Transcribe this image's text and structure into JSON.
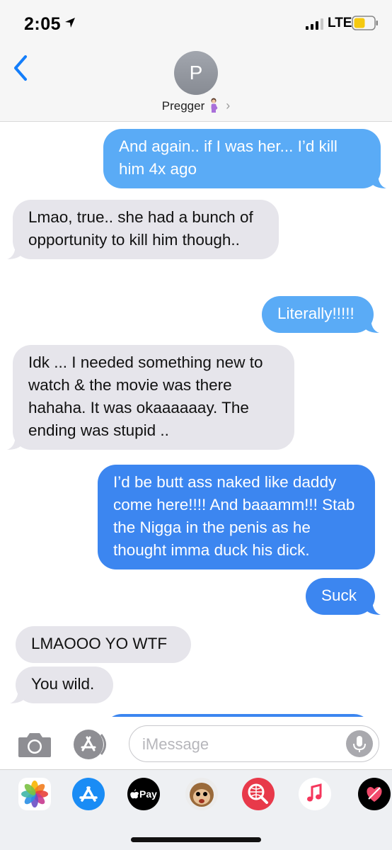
{
  "status_bar": {
    "time": "2:05",
    "network": "LTE"
  },
  "header": {
    "avatar_initial": "P",
    "contact_name": "Pregger"
  },
  "messages": [
    {
      "from": "me",
      "type": "sms",
      "text": "And again.. if I was her... I’d kill him 4x ago"
    },
    {
      "from": "them",
      "text": "Lmao, true.. she had a bunch of opportunity to kill him though.."
    },
    {
      "from": "me",
      "type": "sms",
      "text": "Literally!!!!!"
    },
    {
      "from": "them",
      "text": "Idk ... I needed something new to watch & the movie was there hahaha. It was okaaaaaay. The ending was stupid .."
    },
    {
      "from": "me",
      "type": "imessage",
      "text": "I’d be butt ass naked like daddy come here!!!! And baaamm!!! Stab the Nigga in the penis as he thought imma duck his dick."
    },
    {
      "from": "me",
      "type": "imessage",
      "text": "Suck"
    },
    {
      "from": "them",
      "text": "LMAOOO YO WTF"
    },
    {
      "from": "them",
      "text": "You wild."
    }
  ],
  "composer": {
    "placeholder": "iMessage"
  },
  "app_drawer": {
    "apps": [
      "photos-icon",
      "app-store-icon",
      "apple-pay-icon",
      "animoji-icon",
      "web-images-icon",
      "music-icon",
      "digital-touch-icon"
    ],
    "apple_pay_label": "Pay"
  },
  "colors": {
    "sms_bubble": "#5aabf6",
    "imessage_bubble": "#3c86f0",
    "received_bubble": "#e6e5eb",
    "accent": "#147efb"
  }
}
